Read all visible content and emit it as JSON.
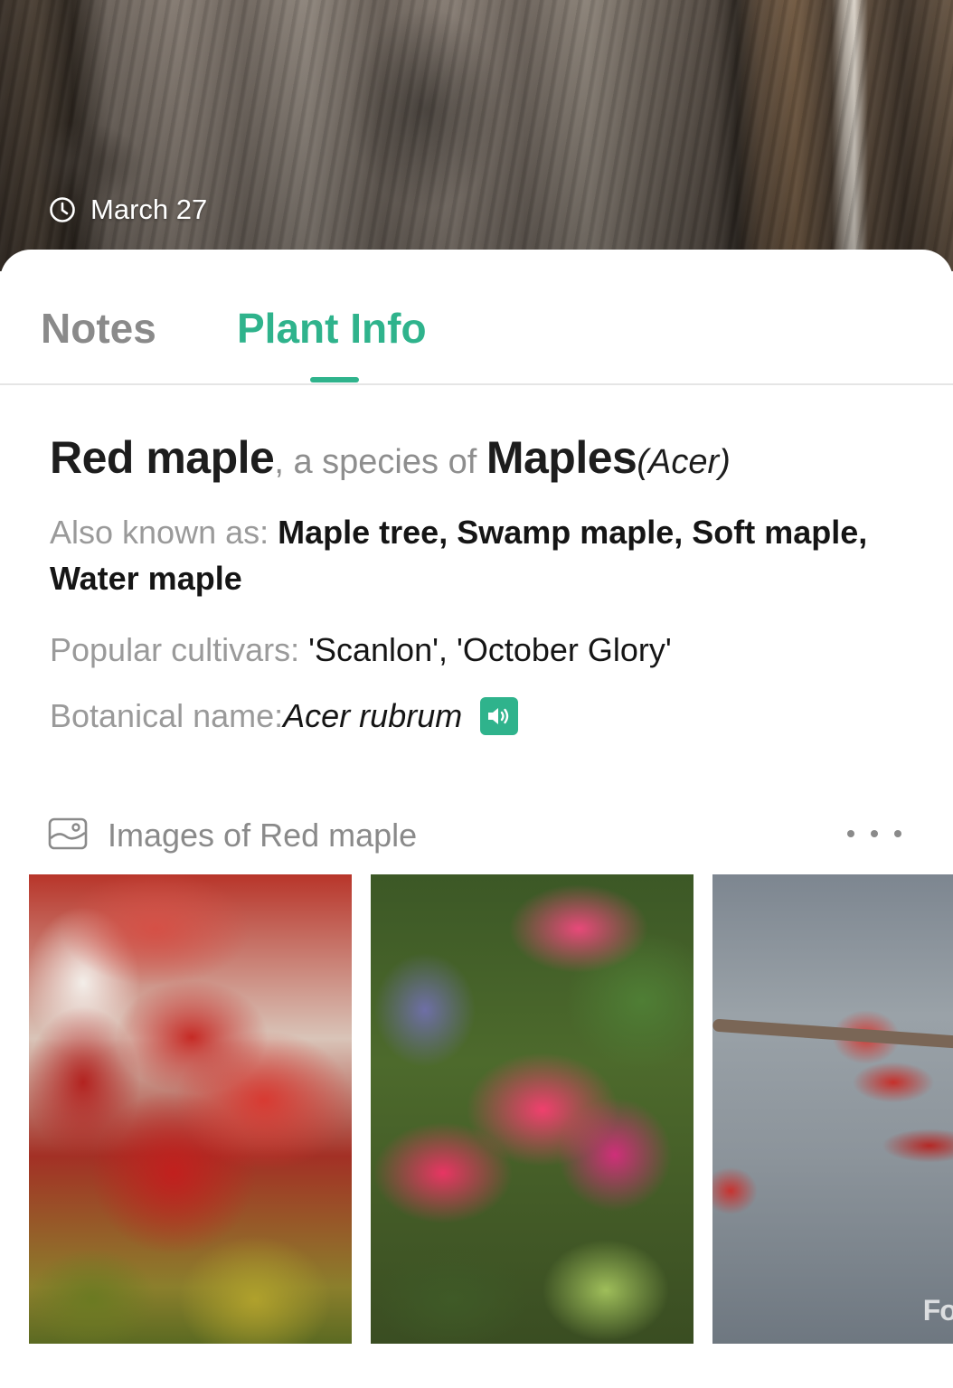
{
  "hero": {
    "date": "March 27",
    "icon": "clock-icon"
  },
  "tabs": [
    {
      "label": "Notes",
      "active": false
    },
    {
      "label": "Plant Info",
      "active": true
    }
  ],
  "accent_color": "#2fb38c",
  "plant": {
    "common_name": "Red maple",
    "species_of_text": ", a species of ",
    "genus": "Maples",
    "genus_latin": "(Acer)",
    "aka_label": "Also known as: ",
    "aka_value": "Maple tree, Swamp maple, Soft maple, Water maple",
    "cultivars_label": "Popular cultivars: ",
    "cultivars_value": "'Scanlon', 'October Glory'",
    "botanical_label": "Botanical name: ",
    "botanical_value": "Acer rubrum",
    "speaker_icon": "speaker-icon"
  },
  "images": {
    "title": "Images of Red maple",
    "icon": "image-icon",
    "more_icon": "more-dots-icon",
    "photos": [
      "red-maple-leaves-photo",
      "red-maple-foliage-photo",
      "red-maple-seeds-photo"
    ],
    "watermark": "For Sale"
  }
}
